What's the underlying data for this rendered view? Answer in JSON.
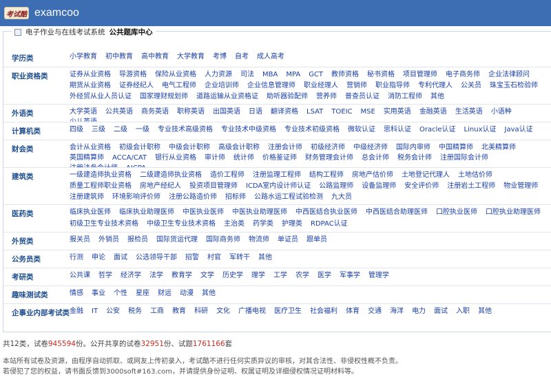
{
  "header": {
    "logo_seal": "考试酷",
    "logo_text": "examcoo"
  },
  "breadcrumb": {
    "home": "电子作业与在线考试系统",
    "current": "公共题库中心"
  },
  "categories": [
    {
      "name": "学历类",
      "items": [
        "小学教育",
        "初中教育",
        "高中教育",
        "大学教育",
        "考博",
        "自考",
        "成人高考"
      ]
    },
    {
      "name": "职业资格类",
      "items": [
        "证券从业资格",
        "导游资格",
        "保险从业资格",
        "人力资源",
        "司法",
        "MBA",
        "MPA",
        "GCT",
        "教师资格",
        "秘书资格",
        "项目管理师",
        "电子商务师",
        "企业法律顾问",
        "期货从业资格",
        "证券经纪人",
        "电气工程师",
        "企业培训师",
        "企业信息管理师",
        "职业经理人",
        "营销师",
        "职业指导师",
        "专利代理人",
        "公关员",
        "珠宝玉石检验师",
        "外经贸从业人员认证",
        "国家理财规划师",
        "道路运输从业资格证",
        "助听器验配师",
        "营养师",
        "普查员认证",
        "消防工程师",
        "其他"
      ]
    },
    {
      "name": "外语类",
      "items": [
        "大学英语",
        "公共英语",
        "商务英语",
        "职称英语",
        "出国英语",
        "日语",
        "翻译资格",
        "LSAT",
        "TOEIC",
        "MSE",
        "实用英语",
        "金融英语",
        "生活英语",
        "小语种",
        "少儿英语"
      ]
    },
    {
      "name": "计算机类",
      "items": [
        "四级",
        "三级",
        "二级",
        "一级",
        "专业技术高级资格",
        "专业技术中级资格",
        "专业技术初级资格",
        "微软认证",
        "思科认证",
        "Oracle认证",
        "Linux认证",
        "Java认证"
      ]
    },
    {
      "name": "财会类",
      "items": [
        "会计从业资格",
        "初级会计职称",
        "中级会计职称",
        "高级会计职称",
        "注册会计师",
        "初级经济师",
        "中级经济师",
        "国际内审师",
        "中国精算师",
        "北美精算师",
        "英国精算师",
        "ACCA/CAT",
        "银行从业资格",
        "审计师",
        "统计师",
        "价格鉴证师",
        "财务管理会计师",
        "总会计师",
        "税务会计师",
        "注册国际会计师",
        "注册法务会计师",
        "AICPA"
      ]
    },
    {
      "name": "建筑类",
      "items": [
        "一级建造师执业资格",
        "二级建造师执业资格",
        "造价工程师",
        "注册监理工程师",
        "结构工程师",
        "房地产估价师",
        "土地登记代理人",
        "土地估价师",
        "质量工程师职业资格",
        "房地产经纪人",
        "投资项目管理师",
        "ICDA室内设计师认证",
        "公路监理师",
        "设备监理师",
        "安全评价师",
        "注册岩土工程师",
        "物业管理师",
        "注册建筑师",
        "环境影响评价师",
        "注册公路造价师",
        "招标师",
        "公路水运工程试验检测",
        "九大员"
      ]
    },
    {
      "name": "医药类",
      "items": [
        "临床执业医师",
        "临床执业助理医师",
        "中医执业医师",
        "中医执业助理医师",
        "中西医结合执业医师",
        "中西医结合助理医师",
        "口腔执业医师",
        "口腔执业助理医师",
        "初级卫生专业技术资格",
        "中级卫生专业技术资格",
        "主治类",
        "药学类",
        "护理类",
        "RDPAC认证"
      ]
    },
    {
      "name": "外贸类",
      "items": [
        "报关员",
        "外销员",
        "报检员",
        "国际货运代理",
        "国际商务师",
        "物流师",
        "单证员",
        "跟单员"
      ]
    },
    {
      "name": "公务员类",
      "items": [
        "行测",
        "申论",
        "面试",
        "公选领导干部",
        "招警",
        "村官",
        "军转干",
        "其他"
      ]
    },
    {
      "name": "考研类",
      "items": [
        "公共课",
        "哲学",
        "经济学",
        "法学",
        "教育学",
        "文学",
        "历史学",
        "理学",
        "工学",
        "农学",
        "医学",
        "军事学",
        "管理学"
      ]
    },
    {
      "name": "趣味测试类",
      "items": [
        "情感",
        "事业",
        "个性",
        "星座",
        "财运",
        "动漫",
        "其他"
      ]
    },
    {
      "name": "企事业内部考试类",
      "items": [
        "金融",
        "IT",
        "公安",
        "税务",
        "工商",
        "教育",
        "科研",
        "文化",
        "广播电视",
        "医疗卫生",
        "社会福利",
        "体育",
        "交通",
        "海洋",
        "电力",
        "面试",
        "入职",
        "其他"
      ]
    }
  ],
  "stats": {
    "prefix": "共12类，试卷",
    "total_papers": "945594",
    "mid1": "份。公开共享的试卷",
    "shared_papers": "32951",
    "mid2": "份、试题",
    "questions": "1761166",
    "suffix": "套"
  },
  "notice": {
    "line1": "本站所有试卷及资源，由程序自动抓取、或网友上传初录入，考试酷不进行任何实质异议的审核，对其合法性、非侵权性概不负责。",
    "line2": "若侵犯了您的权益，请书面反馈到3000soft#163.com，并请提供身份证明、权属证明及详细侵权情况证明材料等。"
  }
}
